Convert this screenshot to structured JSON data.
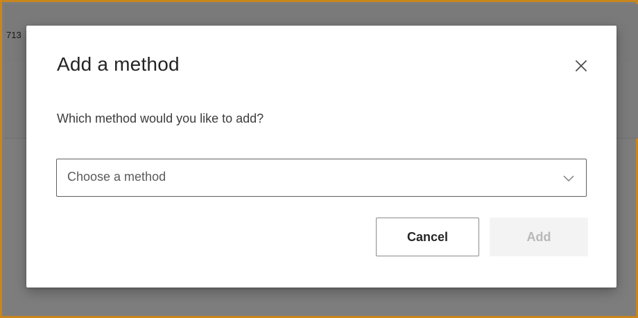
{
  "background": {
    "partial_text": "713"
  },
  "dialog": {
    "title": "Add a method",
    "question": "Which method would you like to add?",
    "select": {
      "placeholder": "Choose a method"
    },
    "buttons": {
      "cancel": "Cancel",
      "add": "Add"
    }
  },
  "icons": {
    "close": "close-icon",
    "dropdown": "chevron-down-icon"
  },
  "colors": {
    "frame_border": "#c8861c",
    "overlay": "#7d7d7d",
    "dialog_bg": "#ffffff",
    "disabled_button_bg": "#f3f3f3",
    "disabled_button_text": "#b8b8b8"
  }
}
